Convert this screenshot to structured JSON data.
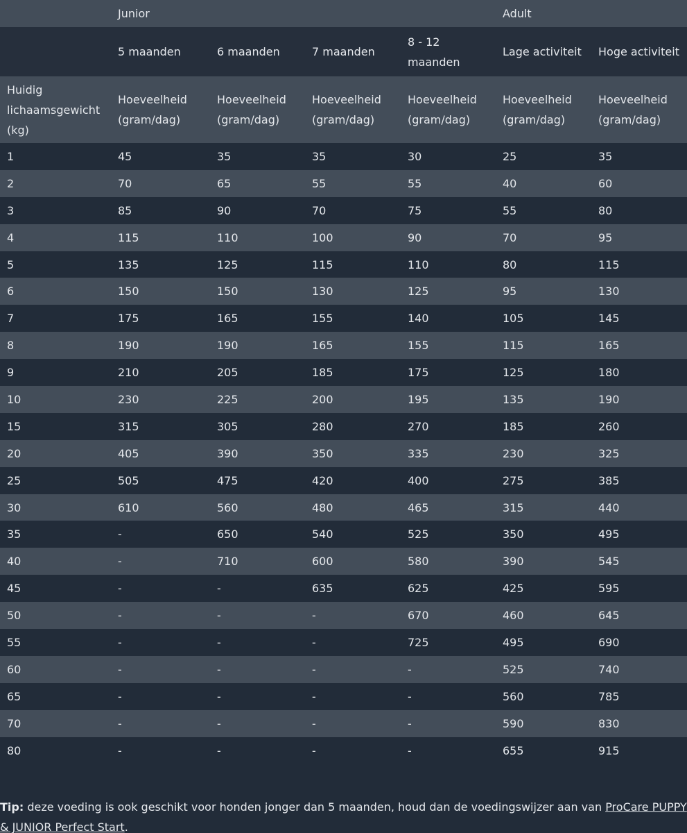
{
  "table": {
    "group_row": [
      "",
      "Junior",
      "",
      "",
      "",
      "Adult",
      ""
    ],
    "sub_row": [
      "",
      "5 maanden",
      "6  maanden",
      "7 maanden",
      "8 - 12 maanden",
      "Lage activiteit",
      "Hoge activiteit"
    ],
    "unit_row": [
      "Huidig lichaamsgewicht (kg)",
      "Hoeveelheid (gram/dag)",
      "Hoeveelheid (gram/dag)",
      "Hoeveelheid (gram/dag)",
      "Hoeveelheid (gram/dag)",
      "Hoeveelheid (gram/dag)",
      "Hoeveelheid (gram/dag)"
    ],
    "rows": [
      [
        "1",
        "45",
        "35",
        "35",
        "30",
        "25",
        "35"
      ],
      [
        "2",
        "70",
        "65",
        "55",
        "55",
        "40",
        "60"
      ],
      [
        "3",
        "85",
        "90",
        "70",
        "75",
        "55",
        "80"
      ],
      [
        "4",
        "115",
        "110",
        "100",
        "90",
        "70",
        "95"
      ],
      [
        "5",
        "135",
        "125",
        "115",
        "110",
        "80",
        "115"
      ],
      [
        "6",
        "150",
        "150",
        "130",
        "125",
        "95",
        "130"
      ],
      [
        "7",
        "175",
        "165",
        "155",
        "140",
        "105",
        "145"
      ],
      [
        "8",
        "190",
        "190",
        "165",
        "155",
        "115",
        "165"
      ],
      [
        "9",
        "210",
        "205",
        "185",
        "175",
        "125",
        "180"
      ],
      [
        "10",
        "230",
        "225",
        "200",
        "195",
        "135",
        "190"
      ],
      [
        "15",
        "315",
        "305",
        "280",
        "270",
        "185",
        "260"
      ],
      [
        "20",
        "405",
        "390",
        "350",
        "335",
        "230",
        "325"
      ],
      [
        "25",
        "505",
        "475",
        "420",
        "400",
        "275",
        "385"
      ],
      [
        "30",
        "610",
        "560",
        "480",
        "465",
        "315",
        "440"
      ],
      [
        "35",
        "-",
        "650",
        "540",
        "525",
        "350",
        "495"
      ],
      [
        "40",
        "-",
        "710",
        "600",
        "580",
        "390",
        "545"
      ],
      [
        "45",
        "-",
        "-",
        "635",
        "625",
        "425",
        "595"
      ],
      [
        "50",
        "-",
        "-",
        "-",
        "670",
        "460",
        "645"
      ],
      [
        "55",
        "-",
        "-",
        "-",
        "725",
        "495",
        "690"
      ],
      [
        "60",
        "-",
        "-",
        "-",
        "-",
        "525",
        "740"
      ],
      [
        "65",
        "-",
        "-",
        "-",
        "-",
        "560",
        "785"
      ],
      [
        "70",
        "-",
        "-",
        "-",
        "-",
        "590",
        "830"
      ],
      [
        "80",
        "-",
        "-",
        "-",
        "-",
        "655",
        "915"
      ]
    ]
  },
  "tip": {
    "label": "Tip:",
    "text": " deze voeding is ook geschikt voor honden jonger dan 5 maanden, houd dan de voedingswijzer aan van ",
    "link": "ProCare PUPPY & JUNIOR Perfect Start",
    "end": "."
  },
  "colors": {
    "background": "#222c39",
    "band": "#434d59",
    "text": "#e4e7eb"
  }
}
